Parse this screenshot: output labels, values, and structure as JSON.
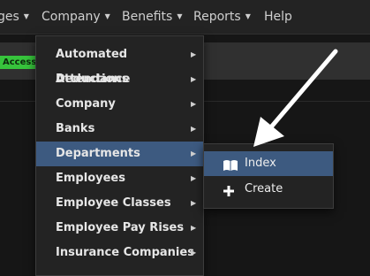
{
  "navbar": {
    "items": [
      {
        "label": "ges"
      },
      {
        "label": "Company"
      },
      {
        "label": "Benefits"
      },
      {
        "label": "Reports"
      },
      {
        "label": "Help"
      }
    ]
  },
  "page": {
    "badge": "Access"
  },
  "dropdown": {
    "items": [
      {
        "label": "Automated Deductions"
      },
      {
        "label": "Attendance"
      },
      {
        "label": "Company"
      },
      {
        "label": "Banks"
      },
      {
        "label": "Departments",
        "active": true
      },
      {
        "label": "Employees"
      },
      {
        "label": "Employee Classes"
      },
      {
        "label": "Employee Pay Rises"
      },
      {
        "label": "Insurance Companies"
      }
    ]
  },
  "submenu": {
    "items": [
      {
        "label": "Index",
        "icon": "book-icon",
        "active": true
      },
      {
        "label": "Create",
        "icon": "plus-icon"
      }
    ]
  },
  "colors": {
    "active_bg": "#3d5a80",
    "badge_bg": "#37c43c",
    "navbar_bg": "#232323"
  }
}
